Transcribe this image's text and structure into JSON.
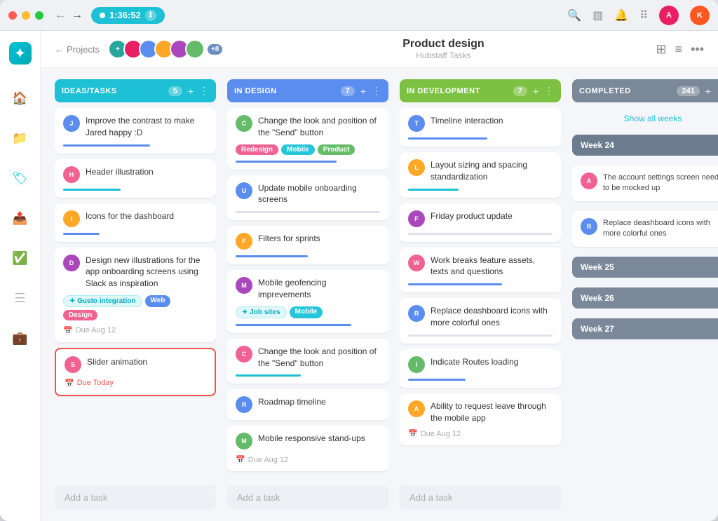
{
  "window": {
    "title": "Product design — Hubstaff Tasks"
  },
  "titlebar": {
    "timer": "1:36:52",
    "nav_back": "←",
    "nav_forward": "→"
  },
  "topbar": {
    "back_label": "Projects",
    "page_title": "Product design",
    "page_subtitle": "Hubstaff Tasks",
    "avatar_count": "+8"
  },
  "columns": [
    {
      "id": "ideas",
      "title": "IDEAS/TASKS",
      "count": 5,
      "color": "cyan",
      "cards": [
        {
          "text": "Improve the contrast to make Jared happy :D",
          "avatar_color": "#5b8def",
          "bar": "blue",
          "bar_width": "60%"
        },
        {
          "text": "Header illustration",
          "avatar_color": "#f06292",
          "bar": "cyan",
          "bar_width": "40%"
        },
        {
          "text": "Icons for the dashboard",
          "avatar_color": "#ffa726",
          "bar": "blue",
          "bar_width": "25%"
        },
        {
          "text": "Design new illustrations for the app onboarding screens using Slack as inspiration",
          "avatar_color": "#ab47bc",
          "tags": [
            "Gusto integration",
            "Web",
            "Design"
          ],
          "due": "Due Aug 12",
          "bar": null
        },
        {
          "text": "Slider animation",
          "avatar_color": "#f06292",
          "highlighted": true,
          "due_overdue": "Due Today"
        }
      ],
      "add_label": "Add a task"
    },
    {
      "id": "indesign",
      "title": "IN DESIGN",
      "count": 7,
      "color": "blue",
      "cards": [
        {
          "text": "Change the look and position of the \"Send\" button",
          "avatar_color": "#66bb6a",
          "tags_colored": [
            "Redesign",
            "Mobile",
            "Product"
          ],
          "bar": "blue",
          "bar_width": "70%"
        },
        {
          "text": "Update mobile onboarding screens",
          "avatar_color": "#5b8def",
          "bar": "light",
          "bar_width": "100%"
        },
        {
          "text": "Filters for sprints",
          "avatar_color": "#ffa726",
          "bar": "blue",
          "bar_width": "50%"
        },
        {
          "text": "Mobile geofencing imprevements",
          "avatar_color": "#ab47bc",
          "tags_outline": [
            "Job sites",
            "Mobile"
          ],
          "bar": "blue",
          "bar_width": "80%"
        },
        {
          "text": "Change the look and position of the \"Send\" button",
          "avatar_color": "#f06292",
          "bar": "cyan",
          "bar_width": "45%"
        },
        {
          "text": "Roadmap timeline",
          "avatar_color": "#5b8def",
          "bar": null
        },
        {
          "text": "Mobile responsive stand-ups",
          "avatar_color": "#66bb6a",
          "due": "Due Aug 12",
          "bar": null
        }
      ],
      "add_label": "Add a task"
    },
    {
      "id": "indevelopment",
      "title": "IN DEVELOPMENT",
      "count": 7,
      "color": "green",
      "cards": [
        {
          "text": "Timeline interaction",
          "avatar_color": "#5b8def",
          "bar": "blue",
          "bar_width": "55%"
        },
        {
          "text": "Layout sizing and spacing standardization",
          "avatar_color": "#ffa726",
          "bar": "cyan",
          "bar_width": "35%"
        },
        {
          "text": "Friday product update",
          "avatar_color": "#ab47bc",
          "bar": "light",
          "bar_width": "100%"
        },
        {
          "text": "Work breaks feature assets, texts and questions",
          "avatar_color": "#f06292",
          "bar": "blue",
          "bar_width": "65%"
        },
        {
          "text": "Replace deashboard icons with more colorful ones",
          "avatar_color": "#5b8def",
          "bar": "light",
          "bar_width": "100%"
        },
        {
          "text": "Indicate Routes loading",
          "avatar_color": "#66bb6a",
          "bar": "blue",
          "bar_width": "40%"
        },
        {
          "text": "Ability to request leave through the mobile app",
          "avatar_color": "#ffa726",
          "due": "Due Aug 12",
          "bar": null
        }
      ],
      "add_label": "Add a task"
    },
    {
      "id": "completed",
      "title": "COMPLETED",
      "count": 241,
      "color": "gray",
      "show_all": "Show all weeks",
      "weeks": [
        {
          "label": "Week 24",
          "open": true,
          "cards": [
            {
              "text": "The account settings screen needs to be mocked up",
              "avatar_color": "#f06292"
            },
            {
              "text": "Replace deashboard icons with more colorful ones",
              "avatar_color": "#5b8def"
            }
          ]
        },
        {
          "label": "Week 25",
          "open": false,
          "cards": []
        },
        {
          "label": "Week 26",
          "open": false,
          "cards": []
        },
        {
          "label": "Week 27",
          "open": false,
          "cards": []
        }
      ]
    }
  ],
  "sidebar": {
    "items": [
      "🏠",
      "📁",
      "🏷",
      "📤",
      "✅",
      "☰",
      "💼"
    ]
  }
}
